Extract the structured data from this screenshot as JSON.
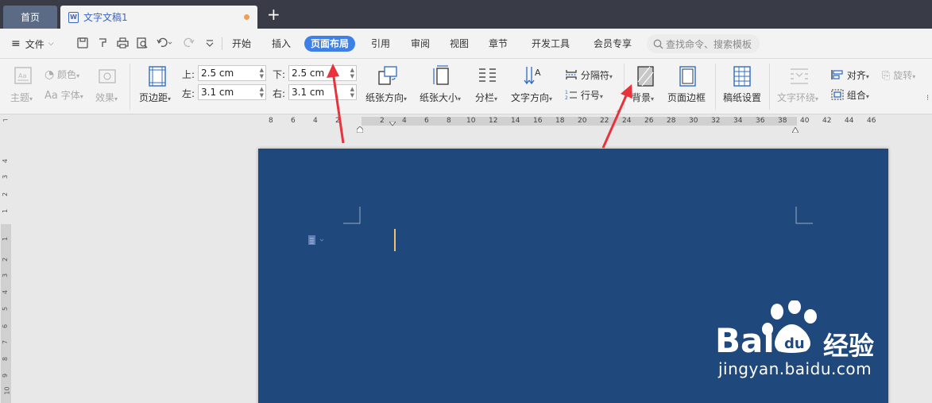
{
  "tabs": {
    "home_label": "首页",
    "doc_label": "文字文稿1",
    "doc_icon": "W",
    "new_tab_icon": "+"
  },
  "menu": {
    "file_label": "文件",
    "tabs": [
      "开始",
      "插入",
      "页面布局",
      "引用",
      "审阅",
      "视图",
      "章节",
      "开发工具",
      "会员专享"
    ],
    "active_tab": "页面布局",
    "search_placeholder": "查找命令、搜索模板"
  },
  "ribbon": {
    "theme_label": "主题",
    "colors_label": "颜色",
    "fonts_label": "字体",
    "effects_label": "效果",
    "margins_label": "页边距",
    "margin_top_label": "上:",
    "margin_top_value": "2.5 cm",
    "margin_bottom_label": "下:",
    "margin_bottom_value": "2.5 cm",
    "margin_left_label": "左:",
    "margin_left_value": "3.1 cm",
    "margin_right_label": "右:",
    "margin_right_value": "3.1 cm",
    "orientation_label": "纸张方向",
    "size_label": "纸张大小",
    "columns_label": "分栏",
    "text_direction_label": "文字方向",
    "breaks_label": "分隔符",
    "line_numbers_label": "行号",
    "background_label": "背景",
    "page_border_label": "页面边框",
    "manuscript_label": "稿纸设置",
    "text_wrap_label": "文字环绕",
    "align_label": "对齐",
    "rotate_label": "旋转",
    "group_label": "组合"
  },
  "ruler": {
    "left_numbers": [
      "8",
      "6",
      "4",
      "2"
    ],
    "right_numbers": [
      "2",
      "4",
      "6",
      "8",
      "10",
      "12",
      "14",
      "16",
      "18",
      "20",
      "22",
      "24",
      "26",
      "28",
      "30",
      "32",
      "34",
      "36",
      "38",
      "40",
      "42",
      "44",
      "46"
    ],
    "vertical_numbers": [
      "4",
      "3",
      "2",
      "1",
      "1",
      "2",
      "3",
      "4",
      "5",
      "6",
      "7",
      "8",
      "9",
      "10"
    ]
  },
  "watermark": {
    "brand": "Bai",
    "brand_paw": "du",
    "brand_cn": "经验",
    "url": "jingyan.baidu.com"
  },
  "colors": {
    "page_background": "#1f497d",
    "accent": "#3f80e6",
    "arrow": "#e8323c",
    "tabbar": "#393c46"
  }
}
